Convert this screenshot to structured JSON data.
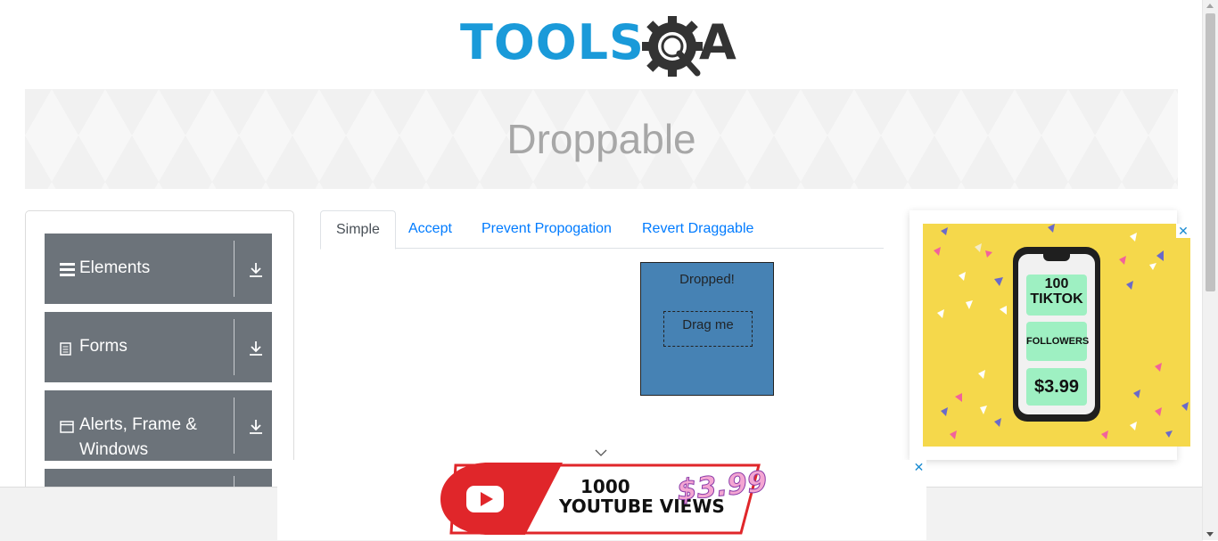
{
  "header": {
    "logo_text": "TOOLS",
    "logo_text_end": "A"
  },
  "banner": {
    "title": "Droppable"
  },
  "sidebar": {
    "groups": [
      {
        "label": "Elements",
        "icon": "hamburger-icon"
      },
      {
        "label": "Forms",
        "icon": "document-icon"
      },
      {
        "label": "Alerts, Frame & Windows",
        "icon": "window-icon"
      }
    ]
  },
  "tabs": [
    {
      "label": "Simple",
      "active": true
    },
    {
      "label": "Accept",
      "active": false
    },
    {
      "label": "Prevent Propogation",
      "active": false
    },
    {
      "label": "Revert Draggable",
      "active": false
    }
  ],
  "droppable": {
    "drop_text": "Dropped!",
    "drag_text": "Drag me",
    "drop_color": "#4682b4"
  },
  "right_ad": {
    "line1": "100",
    "line2": "TIKTOK",
    "line3": "FOLLOWERS",
    "price": "$3.99",
    "close": "✕"
  },
  "bottom_ad": {
    "line1": "1000",
    "line2": "YOUTUBE VIEWS",
    "price": "$3.99",
    "close": "✕"
  },
  "colors": {
    "brand_blue": "#1a9ad9",
    "sidebar_gray": "#6c737a",
    "link_blue": "#007bff"
  }
}
